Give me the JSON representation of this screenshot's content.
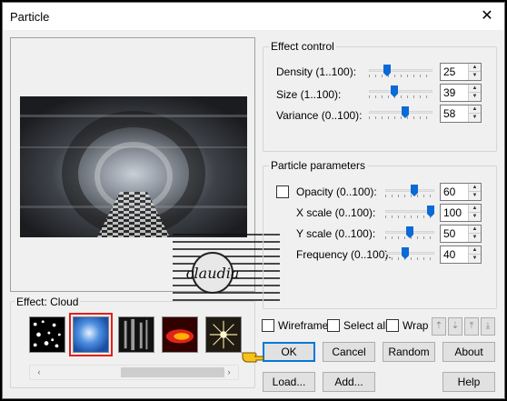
{
  "window": {
    "title": "Particle",
    "close_glyph": "✕"
  },
  "watermark": {
    "text": "claudia"
  },
  "effect": {
    "group_label": "Effect: Cloud",
    "thumbnails": [
      {
        "name": "stars"
      },
      {
        "name": "cloud"
      },
      {
        "name": "smoke"
      },
      {
        "name": "fire"
      },
      {
        "name": "glow"
      }
    ],
    "selected_index": 1,
    "scroll_left": "‹",
    "scroll_right": "›"
  },
  "effect_control": {
    "label": "Effect control",
    "rows": [
      {
        "label": "Density (1..100):",
        "value": "25",
        "level": 0.25
      },
      {
        "label": "Size (1..100):",
        "value": "39",
        "level": 0.39
      },
      {
        "label": "Variance (0..100):",
        "value": "58",
        "level": 0.58
      }
    ]
  },
  "particle_parameters": {
    "label": "Particle parameters",
    "rows": [
      {
        "label": "Opacity (0..100):",
        "value": "60",
        "level": 0.6
      },
      {
        "label": "X scale (0..100):",
        "value": "100",
        "level": 1.0
      },
      {
        "label": "Y scale (0..100):",
        "value": "50",
        "level": 0.5
      },
      {
        "label": "Frequency (0..100):",
        "value": "40",
        "level": 0.4
      }
    ]
  },
  "options": {
    "wireframe": "Wireframe",
    "select_all": "Select all",
    "wrap": "Wrap"
  },
  "buttons": {
    "ok": "OK",
    "cancel": "Cancel",
    "random": "Random",
    "about": "About",
    "load": "Load...",
    "add": "Add...",
    "help": "Help"
  },
  "colors": {
    "accent": "#0078d7",
    "slider": "#0a6ad6",
    "selection": "#e0201c"
  }
}
